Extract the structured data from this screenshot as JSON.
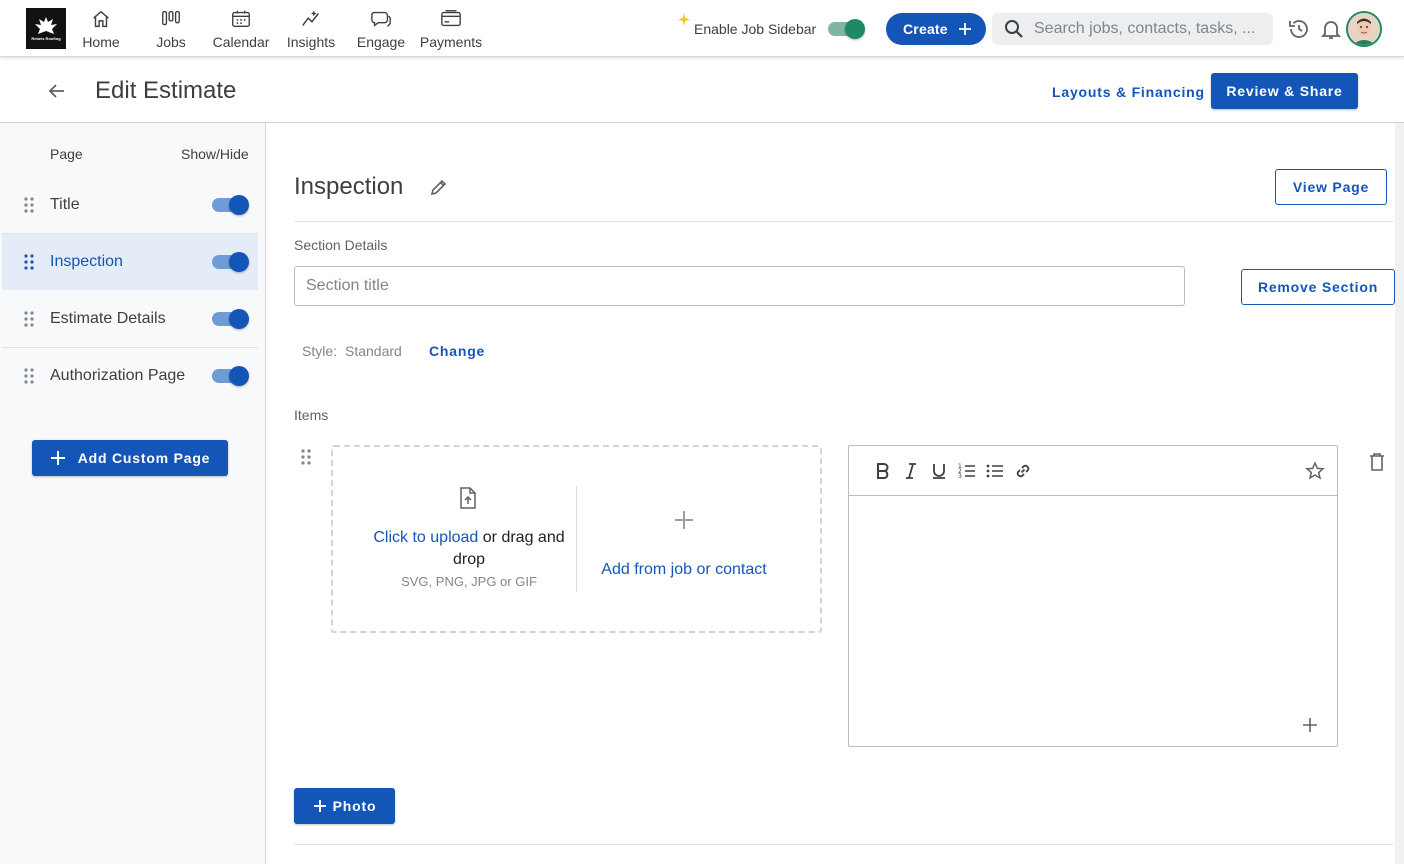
{
  "app": {
    "logo_text": "Rebels Roofing",
    "nav": [
      {
        "label": "Home",
        "icon": "home-icon"
      },
      {
        "label": "Jobs",
        "icon": "jobs-icon"
      },
      {
        "label": "Calendar",
        "icon": "calendar-icon"
      },
      {
        "label": "Insights",
        "icon": "insights-icon"
      },
      {
        "label": "Engage",
        "icon": "engage-icon"
      },
      {
        "label": "Payments",
        "icon": "payments-icon"
      }
    ],
    "job_sidebar_label": "Enable Job Sidebar",
    "job_sidebar_enabled": true,
    "create_label": "Create",
    "search_placeholder": "Search jobs, contacts, tasks, ...",
    "accent_color": "#1456b8",
    "success_color": "#1e8a63"
  },
  "page": {
    "title": "Edit Estimate",
    "layouts_label": "Layouts & Financing",
    "review_label": "Review & Share"
  },
  "pages_panel": {
    "col_page": "Page",
    "col_show_hide": "Show/Hide",
    "items": [
      {
        "label": "Title",
        "visible": true,
        "active": false
      },
      {
        "label": "Inspection",
        "visible": true,
        "active": true
      },
      {
        "label": "Estimate Details",
        "visible": true,
        "active": false
      },
      {
        "label": "Authorization Page",
        "visible": true,
        "active": false
      }
    ],
    "add_custom_label": "Add Custom Page"
  },
  "section": {
    "title": "Inspection",
    "view_page_label": "View Page",
    "details_label": "Section Details",
    "title_placeholder": "Section title",
    "title_value": "",
    "remove_label": "Remove Section",
    "style_label": "Style:",
    "style_value": "Standard",
    "change_label": "Change",
    "items_label": "Items",
    "upload": {
      "click_text": "Click to upload",
      "rest_text_1": " or drag and",
      "rest_text_2": "drop",
      "formats": "SVG, PNG, JPG or GIF",
      "add_from_label": "Add from job or contact"
    },
    "photo_label": "Photo"
  }
}
